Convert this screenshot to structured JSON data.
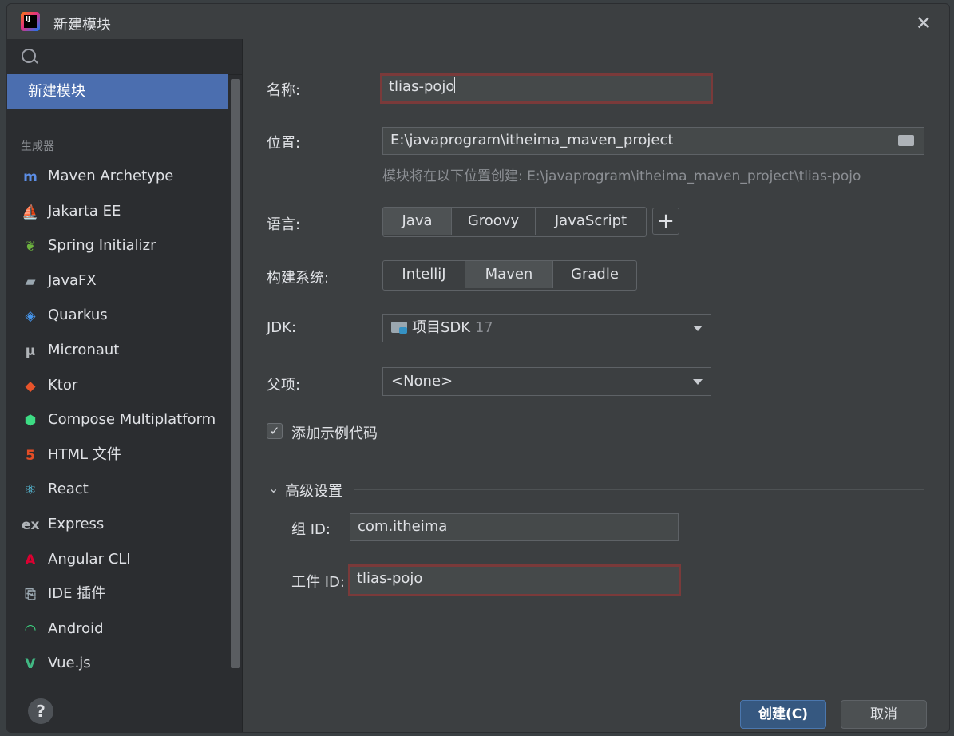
{
  "window": {
    "title": "新建模块"
  },
  "sidebar": {
    "search_placeholder": "",
    "selected_item": "新建模块",
    "section_label": "生成器",
    "generators": [
      {
        "label": "Maven Archetype",
        "icon": "maven-icon",
        "glyph": "m",
        "color": "#5c8ee6"
      },
      {
        "label": "Jakarta EE",
        "icon": "jakarta-icon",
        "glyph": "⛵",
        "color": "#f0a030"
      },
      {
        "label": "Spring Initializr",
        "icon": "spring-icon",
        "glyph": "❦",
        "color": "#6db33f"
      },
      {
        "label": "JavaFX",
        "icon": "javafx-icon",
        "glyph": "▰",
        "color": "#9aa7b0"
      },
      {
        "label": "Quarkus",
        "icon": "quarkus-icon",
        "glyph": "◈",
        "color": "#4695eb"
      },
      {
        "label": "Micronaut",
        "icon": "micronaut-icon",
        "glyph": "μ",
        "color": "#b0b4b8"
      },
      {
        "label": "Ktor",
        "icon": "ktor-icon",
        "glyph": "◆",
        "color": "#e8542b"
      },
      {
        "label": "Compose Multiplatform",
        "icon": "compose-icon",
        "glyph": "⬢",
        "color": "#3ddc84"
      },
      {
        "label": "HTML 文件",
        "icon": "html5-icon",
        "glyph": "5",
        "color": "#e44d26"
      },
      {
        "label": "React",
        "icon": "react-icon",
        "glyph": "⚛",
        "color": "#61dafb"
      },
      {
        "label": "Express",
        "icon": "express-icon",
        "glyph": "ex",
        "color": "#b0b4b8"
      },
      {
        "label": "Angular CLI",
        "icon": "angular-icon",
        "glyph": "A",
        "color": "#dd0031"
      },
      {
        "label": "IDE 插件",
        "icon": "plugin-icon",
        "glyph": "⎘",
        "color": "#9aa7b0"
      },
      {
        "label": "Android",
        "icon": "android-icon",
        "glyph": "◠",
        "color": "#3ddc84"
      },
      {
        "label": "Vue.js",
        "icon": "vue-icon",
        "glyph": "V",
        "color": "#41b883"
      }
    ],
    "help_label": "?"
  },
  "form": {
    "name_label": "名称:",
    "name_value": "tlias-pojo",
    "location_label": "位置:",
    "location_value": "E:\\javaprogram\\itheima_maven_project",
    "location_hint": "模块将在以下位置创建: E:\\javaprogram\\itheima_maven_project\\tlias-pojo",
    "language_label": "语言:",
    "languages": [
      "Java",
      "Groovy",
      "JavaScript"
    ],
    "language_selected": "Java",
    "add_language": "+",
    "build_label": "构建系统:",
    "build_systems": [
      "IntelliJ",
      "Maven",
      "Gradle"
    ],
    "build_selected": "Maven",
    "jdk_label": "JDK:",
    "jdk_value": "项目SDK",
    "jdk_version": "17",
    "parent_label": "父项:",
    "parent_value": "<None>",
    "sample_code_label": "添加示例代码",
    "sample_code_checked": true,
    "advanced_label": "高级设置",
    "group_id_label": "组 ID:",
    "group_id_value": "com.itheima",
    "artifact_id_label": "工件 ID:",
    "artifact_id_value": "tlias-pojo"
  },
  "buttons": {
    "create": "创建(C)",
    "cancel": "取消"
  }
}
